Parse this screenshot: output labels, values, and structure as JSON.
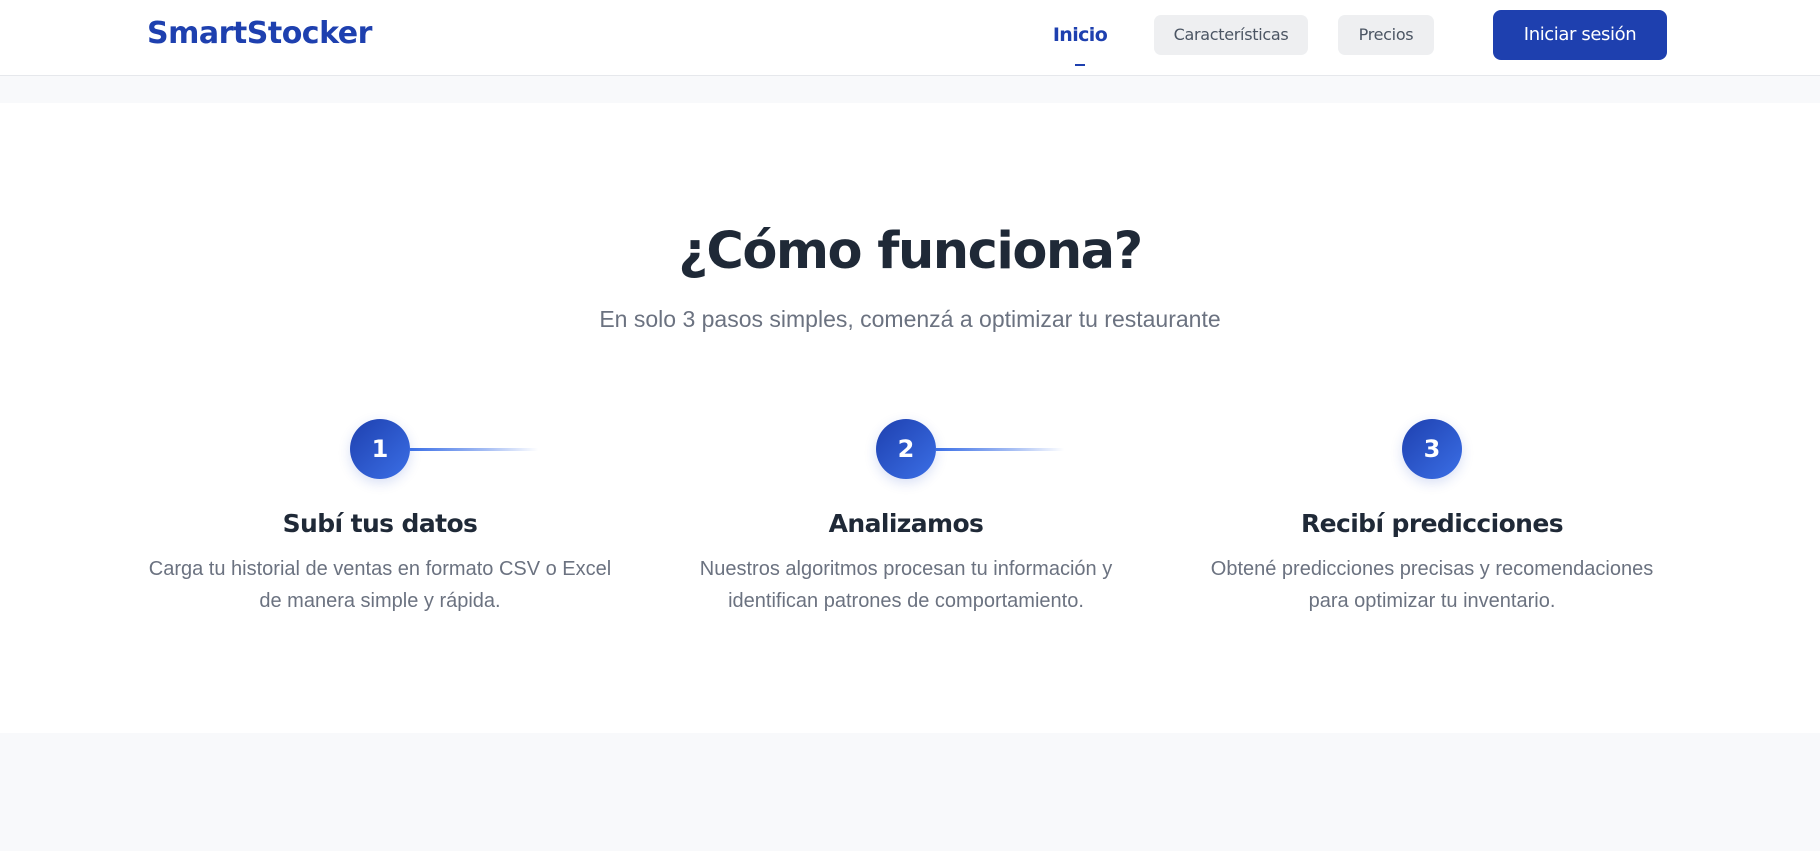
{
  "header": {
    "brand": "SmartStocker",
    "nav": {
      "home": "Inicio",
      "features": "Características",
      "pricing": "Precios"
    },
    "login_label": "Iniciar sesión"
  },
  "how_it_works": {
    "title": "¿Cómo funciona?",
    "subtitle": "En solo 3 pasos simples, comenzá a optimizar tu restaurante",
    "steps": [
      {
        "number": "1",
        "title": "Subí tus datos",
        "description": "Carga tu historial de ventas en formato CSV o Excel de manera simple y rápida."
      },
      {
        "number": "2",
        "title": "Analizamos",
        "description": "Nuestros algoritmos procesan tu información y identifican patrones de comportamiento."
      },
      {
        "number": "3",
        "title": "Recibí predicciones",
        "description": "Obtené predicciones precisas y recomendaciones para optimizar tu inventario."
      }
    ]
  },
  "colors": {
    "brand": "#1e40af",
    "accent": "#3b6fe6",
    "heading": "#1f2937",
    "muted": "#6b7280",
    "page_background": "#f8f9fb"
  }
}
